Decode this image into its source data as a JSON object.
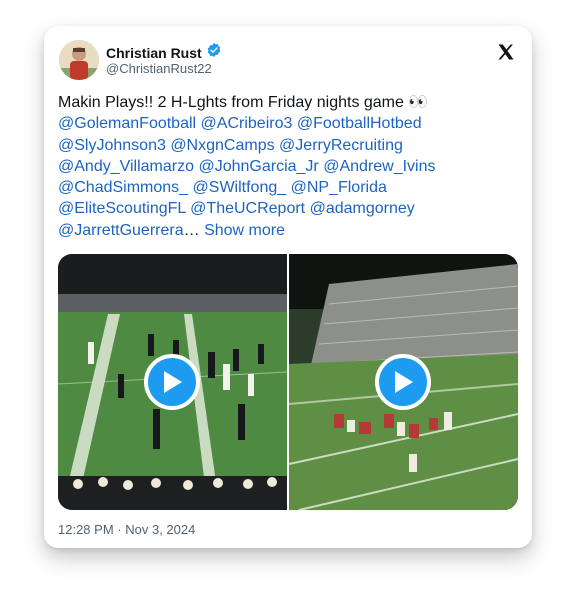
{
  "author": {
    "name": "Christian Rust",
    "handle": "@ChristianRust22",
    "verified_color": "#1d9bf0"
  },
  "tweet": {
    "intro": "Makin Plays!! 2 H-Lghts from Friday nights game",
    "emoji": "👀",
    "mentions": [
      "@GolemanFootball",
      "@ACribeiro3",
      "@FootballHotbed",
      "@SlyJohnson3",
      "@NxgnCamps",
      "@JerryRecruiting",
      "@Andy_Villamarzo",
      "@JohnGarcia_Jr",
      "@Andrew_Ivins",
      "@ChadSimmons_",
      "@SWiltfong_",
      "@NP_Florida",
      "@EliteScoutingFL",
      "@TheUCReport",
      "@adamgorney",
      "@JarrettGuerrera"
    ],
    "ellipsis": "…",
    "show_more": "Show more",
    "link_color": "#1d64c1"
  },
  "media": [
    {
      "label": "football-video-1"
    },
    {
      "label": "football-video-2"
    }
  ],
  "footer": {
    "time": "12:28 PM",
    "separator": "·",
    "date": "Nov 3, 2024"
  }
}
